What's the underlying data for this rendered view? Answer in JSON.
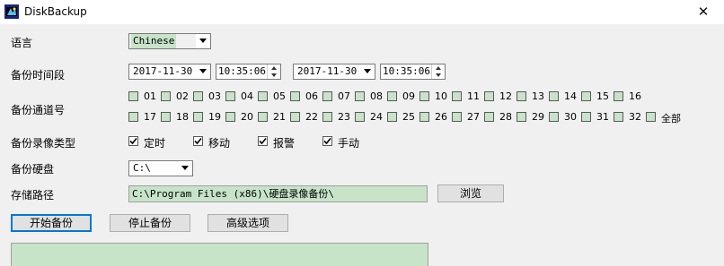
{
  "window": {
    "title": "DiskBackup",
    "close_glyph": "✕"
  },
  "labels": {
    "language": "语言",
    "time_range": "备份时间段",
    "channels": "备份通道号",
    "record_type": "备份录像类型",
    "disk": "备份硬盘",
    "path": "存储路径"
  },
  "language": {
    "value": "Chinese"
  },
  "time": {
    "start_date": "2017-11-30",
    "start_time": "10:35:06",
    "end_date": "2017-11-30",
    "end_time": "10:35:06"
  },
  "channels": {
    "row1": [
      "01",
      "02",
      "03",
      "04",
      "05",
      "06",
      "07",
      "08",
      "09",
      "10",
      "11",
      "12",
      "13",
      "14",
      "15",
      "16"
    ],
    "row2": [
      "17",
      "18",
      "19",
      "20",
      "21",
      "22",
      "23",
      "24",
      "25",
      "26",
      "27",
      "28",
      "29",
      "30",
      "31",
      "32"
    ],
    "all_label": "全部"
  },
  "record_types": [
    {
      "label": "定时",
      "checked": true
    },
    {
      "label": "移动",
      "checked": true
    },
    {
      "label": "报警",
      "checked": true
    },
    {
      "label": "手动",
      "checked": true
    }
  ],
  "disk": {
    "value": "C:\\"
  },
  "storage_path": {
    "value": "C:\\Program Files (x86)\\硬盘录像备份\\"
  },
  "buttons": {
    "browse": "浏览",
    "start": "开始备份",
    "stop": "停止备份",
    "advanced": "高级选项"
  },
  "colors": {
    "field_bg": "#c7e3c8",
    "focus": "#0078d7"
  }
}
